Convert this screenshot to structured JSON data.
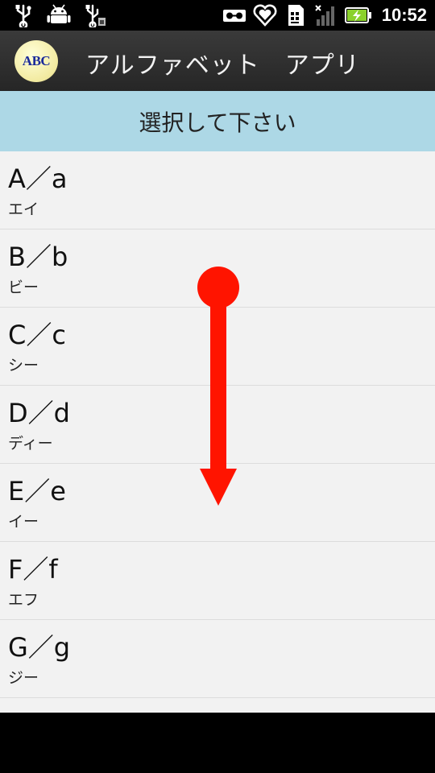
{
  "status_bar": {
    "time": "10:52",
    "icons_left": [
      "usb-icon",
      "android-debug-icon",
      "usb-storage-icon"
    ],
    "icons_right": [
      "voicemail-icon",
      "heart-icon",
      "sim-icon",
      "signal-icon",
      "battery-charging-icon"
    ]
  },
  "app_bar": {
    "logo_text": "ABC",
    "title": "アルファベット　アプリ"
  },
  "header": {
    "text": "選択して下さい"
  },
  "items": [
    {
      "main": "A／a",
      "sub": "エイ"
    },
    {
      "main": "B／b",
      "sub": "ビー"
    },
    {
      "main": "C／c",
      "sub": "シー"
    },
    {
      "main": "D／d",
      "sub": "ディー"
    },
    {
      "main": "E／e",
      "sub": "イー"
    },
    {
      "main": "F／f",
      "sub": "エフ"
    },
    {
      "main": "G／g",
      "sub": "ジー"
    }
  ],
  "gesture": {
    "type": "swipe-down",
    "color": "#ff1400"
  },
  "colors": {
    "header_bg": "#add8e6",
    "list_bg": "#f2f2f2",
    "title_bar_bg": "#2e2e2e",
    "logo_text": "#1a2a9a",
    "battery_green": "#8bd12d"
  }
}
